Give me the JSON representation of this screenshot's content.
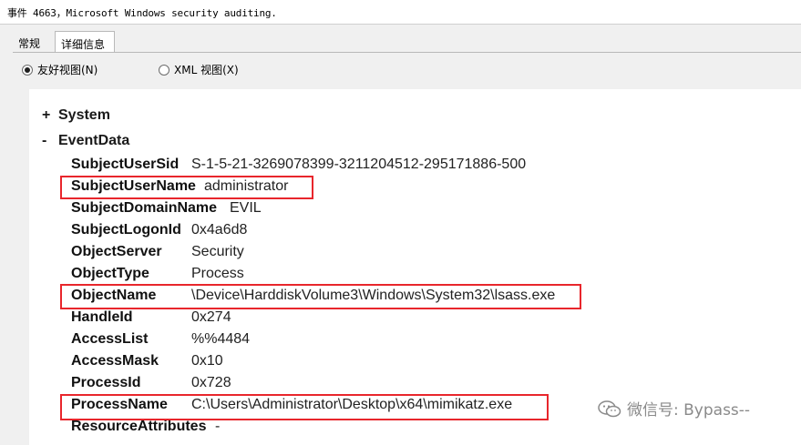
{
  "window": {
    "title": "事件 4663，Microsoft Windows security auditing."
  },
  "tabs": [
    {
      "label": "常规",
      "active": false
    },
    {
      "label": "详细信息",
      "active": true
    }
  ],
  "view_options": {
    "friendly": {
      "label": "友好视图(N)",
      "selected": true
    },
    "xml": {
      "label": "XML 视图(X)",
      "selected": false
    }
  },
  "tree": {
    "system": {
      "toggle": "+",
      "label": "System"
    },
    "eventdata": {
      "toggle": "-",
      "label": "EventData"
    }
  },
  "fields": [
    {
      "name": "SubjectUserSid",
      "value": "S-1-5-21-3269078399-3211204512-295171886-500"
    },
    {
      "name": "SubjectUserName",
      "value": "administrator"
    },
    {
      "name": "SubjectDomainName",
      "value": "EVIL"
    },
    {
      "name": "SubjectLogonId",
      "value": "0x4a6d8"
    },
    {
      "name": "ObjectServer",
      "value": "Security"
    },
    {
      "name": "ObjectType",
      "value": "Process"
    },
    {
      "name": "ObjectName",
      "value": "\\Device\\HarddiskVolume3\\Windows\\System32\\lsass.exe"
    },
    {
      "name": "HandleId",
      "value": "0x274"
    },
    {
      "name": "AccessList",
      "value": "%%4484"
    },
    {
      "name": "AccessMask",
      "value": "0x10"
    },
    {
      "name": "ProcessId",
      "value": "0x728"
    },
    {
      "name": "ProcessName",
      "value": "C:\\Users\\Administrator\\Desktop\\x64\\mimikatz.exe"
    },
    {
      "name": "ResourceAttributes",
      "value": "-"
    }
  ],
  "highlight_color": "#e8262c",
  "watermark": {
    "text": "微信号: Bypass--",
    "icon": "wechat-icon"
  }
}
